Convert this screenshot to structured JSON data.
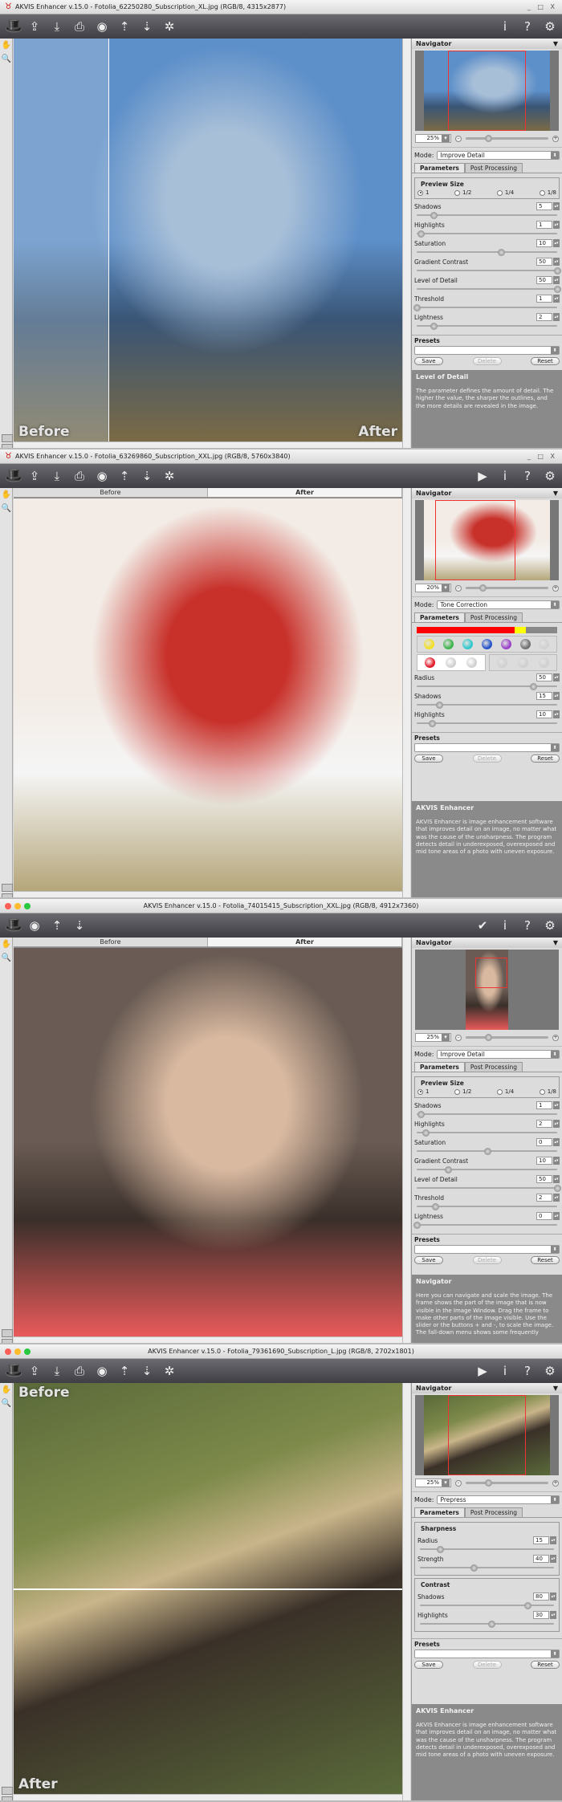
{
  "windows": [
    {
      "os": "win",
      "title": "AKVIS Enhancer v.15.0 - Fotolia_62250280_Subscription_XL.jpg (RGB/8, 4315x2877)",
      "window_controls": "_ □ X",
      "toolbar_left": [
        "open-icon",
        "save-icon",
        "print-icon",
        "share-icon",
        "import-preset-icon",
        "export-preset-icon",
        "batch-settings-icon"
      ],
      "toolbar_right": [
        "info-icon",
        "help-icon",
        "settings-icon"
      ],
      "view_tabs": [],
      "overlay_labels": [
        "Before",
        "After"
      ],
      "photo_colors": [
        "#5d8fc9",
        "#a8bfd8",
        "#3a5575",
        "#7a6a45"
      ],
      "split": "vertical",
      "navigator": {
        "title": "Navigator",
        "zoom": "25%",
        "zoom_fraction": 0.27
      },
      "mode_label": "Mode:",
      "mode": "Improve Detail",
      "tabs": [
        "Parameters",
        "Post Processing"
      ],
      "preview_size": {
        "title": "Preview Size",
        "options": [
          "1",
          "1/2",
          "1/4",
          "1/8"
        ],
        "selected": 0
      },
      "groups": [
        {
          "title": "",
          "sliders": [
            {
              "label": "Shadows",
              "value": "5",
              "fraction": 0.12
            },
            {
              "label": "Highlights",
              "value": "1",
              "fraction": 0.03
            },
            {
              "label": "Saturation",
              "value": "10",
              "fraction": 0.6
            },
            {
              "label": "Gradient Contrast",
              "value": "50",
              "fraction": 1.0
            },
            {
              "label": "Level of Detail",
              "value": "50",
              "fraction": 1.0
            },
            {
              "label": "Threshold",
              "value": "1",
              "fraction": 0.0
            },
            {
              "label": "Lightness",
              "value": "2",
              "fraction": 0.12
            }
          ]
        }
      ],
      "presets": {
        "title": "Presets",
        "save": "Save",
        "delete": "Delete",
        "reset": "Reset"
      },
      "help": {
        "title": "Level of Detail",
        "text": "The parameter defines the amount of detail. The higher the value, the sharper the outlines, and the more details are revealed in the image."
      }
    },
    {
      "os": "win",
      "title": "AKVIS Enhancer v.15.0 - Fotolia_63269860_Subscription_XXL.jpg (RGB/8, 5760x3840)",
      "window_controls": "_ □ X",
      "toolbar_left": [
        "open-icon",
        "save-icon",
        "print-icon",
        "share-icon",
        "import-preset-icon",
        "export-preset-icon",
        "batch-settings-icon"
      ],
      "toolbar_right": [
        "run-icon",
        "info-icon",
        "help-icon",
        "settings-icon"
      ],
      "view_tabs": [
        "Before",
        "After"
      ],
      "overlay_labels": [],
      "photo_colors": [
        "#f3ece6",
        "#c8302a",
        "#f5f5f5",
        "#b5a67a"
      ],
      "split": "none",
      "navigator": {
        "title": "Navigator",
        "zoom": "20%",
        "zoom_fraction": 0.2
      },
      "mode_label": "Mode:",
      "mode": "Tone Correction",
      "tabs": [
        "Parameters",
        "Post Processing"
      ],
      "tone": {
        "bar_colors": [
          "#ff0000",
          "#ffff00",
          "#888888"
        ],
        "bar_fractions": [
          0.7,
          0.08,
          0.22
        ],
        "swatches": [
          "#f2e020",
          "#3cb34a",
          "#2ec8cc",
          "#2452c8",
          "#9a40c8",
          "#707070",
          "#d0d0d0"
        ],
        "picked": [
          "#e01a2a",
          "#d0d0d0",
          "#d0d0d0"
        ],
        "picked2": [
          "#d0d0d0",
          "#d0d0d0",
          "#d0d0d0"
        ]
      },
      "groups": [
        {
          "title": "",
          "sliders": [
            {
              "label": "Radius",
              "value": "50",
              "fraction": 0.83
            },
            {
              "label": "Shadows",
              "value": "15",
              "fraction": 0.16
            },
            {
              "label": "Highlights",
              "value": "10",
              "fraction": 0.11
            }
          ]
        }
      ],
      "presets": {
        "title": "Presets",
        "save": "Save",
        "delete": "Delete",
        "reset": "Reset"
      },
      "help": {
        "title": "AKVIS Enhancer",
        "text": "AKVIS Enhancer is image enhancement software that improves detail on an image, no matter what was the cause of the unsharpness. The program detects detail in underexposed, overexposed and mid tone areas of a photo with uneven exposure."
      }
    },
    {
      "os": "mac",
      "title": "AKVIS Enhancer v.15.0 - Fotolia_74015415_Subscription_XXL.jpg (RGB/8, 4912x7360)",
      "toolbar_left": [
        "share-icon",
        "import-preset-icon",
        "export-preset-icon"
      ],
      "toolbar_right": [
        "apply-checkmark-icon",
        "info-icon",
        "help-icon",
        "settings-icon"
      ],
      "view_tabs": [
        "Before",
        "After"
      ],
      "overlay_labels": [],
      "photo_colors": [
        "#6a5c54",
        "#d9b9a0",
        "#3a2f2a",
        "#e85a5a"
      ],
      "split": "none",
      "navigator": {
        "title": "Navigator",
        "zoom": "25%",
        "zoom_fraction": 0.27
      },
      "mode_label": "Mode:",
      "mode": "Improve Detail",
      "tabs": [
        "Parameters",
        "Post Processing"
      ],
      "preview_size": {
        "title": "Preview Size",
        "options": [
          "1",
          "1/2",
          "1/4",
          "1/8"
        ],
        "selected": 0
      },
      "groups": [
        {
          "title": "",
          "sliders": [
            {
              "label": "Shadows",
              "value": "1",
              "fraction": 0.03
            },
            {
              "label": "Highlights",
              "value": "2",
              "fraction": 0.06
            },
            {
              "label": "Saturation",
              "value": "0",
              "fraction": 0.5
            },
            {
              "label": "Gradient Contrast",
              "value": "10",
              "fraction": 0.22
            },
            {
              "label": "Level of Detail",
              "value": "50",
              "fraction": 1.0
            },
            {
              "label": "Threshold",
              "value": "2",
              "fraction": 0.13
            },
            {
              "label": "Lightness",
              "value": "0",
              "fraction": 0.0
            }
          ]
        }
      ],
      "presets": {
        "title": "Presets",
        "save": "Save",
        "delete": "Delete",
        "reset": "Reset"
      },
      "help": {
        "title": "Navigator",
        "text": "Here you can navigate and scale the image. The frame shows the part of the image that is now visible in the Image Window. Drag the frame to make other parts of the image visible. Use the slider or the buttons + and -, to scale the image. The fall-down menu shows some frequently"
      }
    },
    {
      "os": "mac",
      "title": "AKVIS Enhancer v.15.0 - Fotolia_79361690_Subscription_L.jpg (RGB/8, 2702x1801)",
      "toolbar_left": [
        "open-icon",
        "save-icon",
        "print-icon",
        "share-icon",
        "import-preset-icon",
        "export-preset-icon",
        "batch-settings-icon"
      ],
      "toolbar_right": [
        "run-icon",
        "info-icon",
        "help-icon",
        "settings-icon"
      ],
      "view_tabs": [],
      "overlay_labels": [
        "Before",
        "After"
      ],
      "photo_colors": [
        "#5a6a3a",
        "#c9b58a",
        "#3a3028",
        "#7d8a4a"
      ],
      "split": "horizontal",
      "navigator": {
        "title": "Navigator",
        "zoom": "25%",
        "zoom_fraction": 0.27
      },
      "mode_label": "Mode:",
      "mode": "Prepress",
      "tabs": [
        "Parameters",
        "Post Processing"
      ],
      "groups": [
        {
          "title": "Sharpness",
          "sliders": [
            {
              "label": "Radius",
              "value": "15",
              "fraction": 0.15
            },
            {
              "label": "Strength",
              "value": "40",
              "fraction": 0.4
            }
          ]
        },
        {
          "title": "Contrast",
          "sliders": [
            {
              "label": "Shadows",
              "value": "80",
              "fraction": 0.8
            },
            {
              "label": "Highlights",
              "value": "30",
              "fraction": 0.53
            }
          ]
        }
      ],
      "presets": {
        "title": "Presets",
        "save": "Save",
        "delete": "Delete",
        "reset": "Reset"
      },
      "help": {
        "title": "AKVIS Enhancer",
        "text": "AKVIS Enhancer is image enhancement software that improves detail on an image, no matter what was the cause of the unsharpness. The program detects detail in underexposed, overexposed and mid tone areas of a photo with uneven exposure."
      }
    }
  ]
}
